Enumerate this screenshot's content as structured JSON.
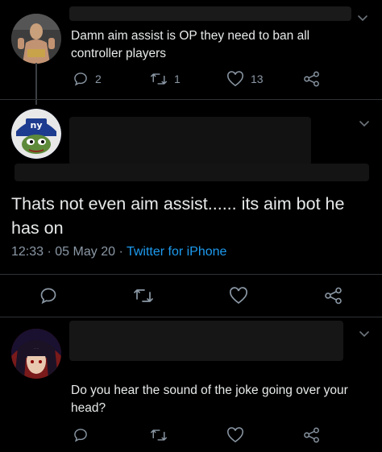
{
  "tweet1": {
    "text": "Damn aim assist is OP they need to ban all controller players",
    "replies": "2",
    "retweets": "1",
    "likes": "13"
  },
  "tweet2": {
    "text": "Thats not even aim assist...... its aim bot he has on",
    "time": "12:33",
    "date": "05 May 20",
    "separator": "·",
    "source": "Twitter for iPhone"
  },
  "tweet3": {
    "text": "Do you hear the sound of the joke going over your head?"
  },
  "colors": {
    "background": "#000000",
    "text": "#e7e9ea",
    "muted": "#8b98a5",
    "link": "#1d9bf0"
  },
  "icons": [
    "reply-icon",
    "retweet-icon",
    "like-icon",
    "share-icon",
    "chevron-down-icon"
  ]
}
